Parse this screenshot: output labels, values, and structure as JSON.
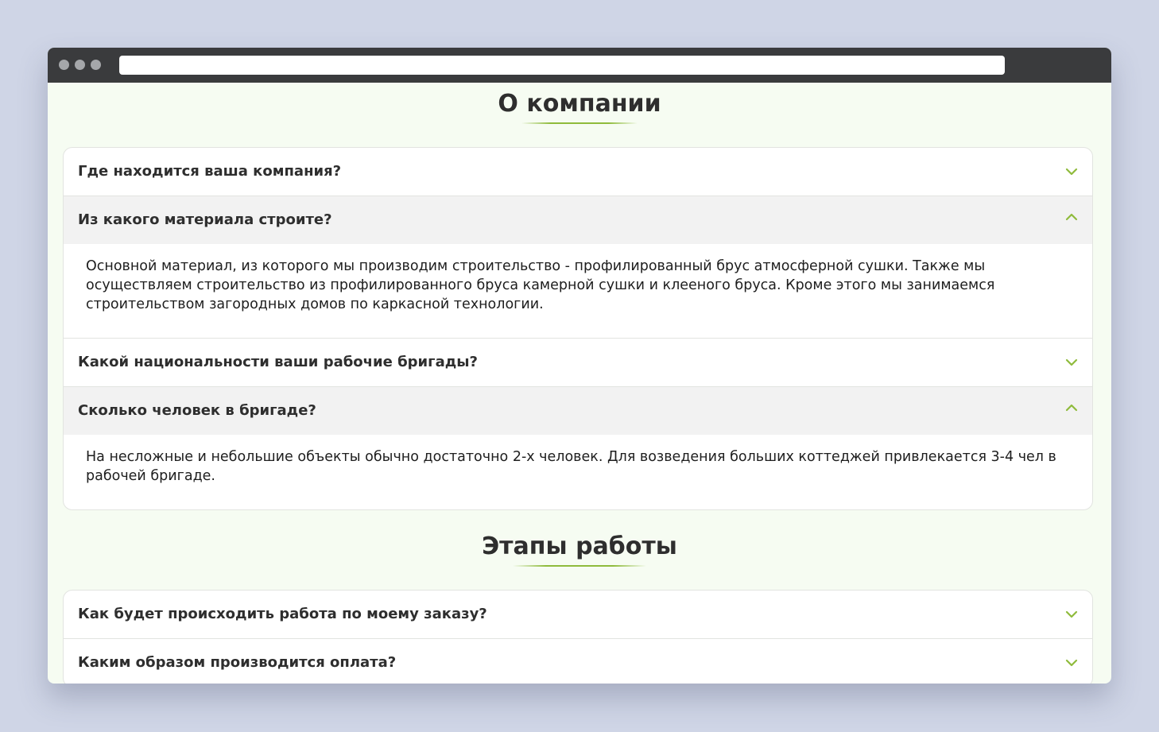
{
  "colors": {
    "accent": "#8fbb3c",
    "page_bg": "#cfd5e6",
    "content_bg": "#f6fcf2",
    "titlebar": "#3a3b3d",
    "open_header_bg": "#f2f2f2"
  },
  "sections": [
    {
      "title": "О компании",
      "items": [
        {
          "question": "Где находится ваша компания?",
          "open": false,
          "icon": "chevron-down-icon"
        },
        {
          "question": "Из какого материала строите?",
          "open": true,
          "icon": "chevron-up-icon",
          "answer": "Основной материал, из которого мы производим строительство - профилированный брус атмосферной сушки. Также мы осуществляем строительство из профилированного бруса камерной сушки и клееного бруса. Кроме этого мы занимаемся строительством загородных домов по каркасной технологии."
        },
        {
          "question": "Какой национальности ваши рабочие бригады?",
          "open": false,
          "icon": "chevron-down-icon"
        },
        {
          "question": "Сколько человек в бригаде?",
          "open": true,
          "icon": "chevron-up-icon",
          "answer": "На несложные и небольшие объекты обычно достаточно 2-х человек. Для возведения больших коттеджей привлекается 3-4 чел в рабочей бригаде."
        }
      ]
    },
    {
      "title": "Этапы работы",
      "items": [
        {
          "question": "Как будет происходить работа по моему заказу?",
          "open": false,
          "icon": "chevron-down-icon"
        },
        {
          "question": "Каким образом производится оплата?",
          "open": false,
          "icon": "chevron-down-icon"
        }
      ]
    }
  ]
}
